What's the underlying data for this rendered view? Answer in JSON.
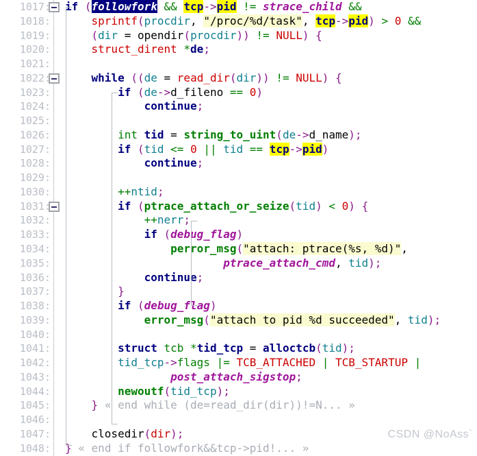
{
  "editor": {
    "first_line": 1017,
    "last_line": 1048,
    "line_number_suffix": ":",
    "fold_lines": [
      1017,
      1022,
      1031
    ],
    "fold_marker": "minus-box",
    "watermark": "CSDN @NoAss`"
  },
  "colors": {
    "background": "#ffffff",
    "gutter_text": "#b9bec6",
    "gutter_border": "#c8cdd4",
    "keyword": "#00007f",
    "type": "#007f00",
    "identifier": "#0f7f8f",
    "function": "#007f00",
    "macro": "#cc0000",
    "paren": "#8b1a8b",
    "string_bg": "#fbfbd0",
    "global_var": "#a0159b",
    "selection_bg": "#000080",
    "selection_fg": "#ffffff",
    "search_highlight_bg": "#ffff00",
    "comment": "#a8adb5",
    "watermark": "#c3c7ce"
  },
  "lines": [
    {
      "n": 1017,
      "fold": true,
      "text": "if (followfork && tcp->pid != strace_child &&"
    },
    {
      "n": 1018,
      "fold": false,
      "text": "    sprintf(procdir, \"/proc/%d/task\", tcp->pid) > 0 &&"
    },
    {
      "n": 1019,
      "fold": false,
      "text": "    (dir = opendir(procdir)) != NULL) {"
    },
    {
      "n": 1020,
      "fold": false,
      "text": "    struct_dirent *de;"
    },
    {
      "n": 1021,
      "fold": false,
      "text": ""
    },
    {
      "n": 1022,
      "fold": true,
      "text": "    while ((de = read_dir(dir)) != NULL) {"
    },
    {
      "n": 1023,
      "fold": false,
      "text": "        if (de->d_fileno == 0)"
    },
    {
      "n": 1024,
      "fold": false,
      "text": "            continue;"
    },
    {
      "n": 1025,
      "fold": false,
      "text": ""
    },
    {
      "n": 1026,
      "fold": false,
      "text": "        int tid = string_to_uint(de->d_name);"
    },
    {
      "n": 1027,
      "fold": false,
      "text": "        if (tid <= 0 || tid == tcp->pid)"
    },
    {
      "n": 1028,
      "fold": false,
      "text": "            continue;"
    },
    {
      "n": 1029,
      "fold": false,
      "text": ""
    },
    {
      "n": 1030,
      "fold": false,
      "text": "        ++ntid;"
    },
    {
      "n": 1031,
      "fold": true,
      "text": "        if (ptrace_attach_or_seize(tid) < 0) {"
    },
    {
      "n": 1032,
      "fold": false,
      "text": "            ++nerr;"
    },
    {
      "n": 1033,
      "fold": false,
      "text": "            if (debug_flag)"
    },
    {
      "n": 1034,
      "fold": false,
      "text": "                perror_msg(\"attach: ptrace(%s, %d)\","
    },
    {
      "n": 1035,
      "fold": false,
      "text": "                        ptrace_attach_cmd, tid);"
    },
    {
      "n": 1036,
      "fold": false,
      "text": "            continue;"
    },
    {
      "n": 1037,
      "fold": false,
      "text": "        }"
    },
    {
      "n": 1038,
      "fold": false,
      "text": "        if (debug_flag)"
    },
    {
      "n": 1039,
      "fold": false,
      "text": "            error_msg(\"attach to pid %d succeeded\", tid);"
    },
    {
      "n": 1040,
      "fold": false,
      "text": ""
    },
    {
      "n": 1041,
      "fold": false,
      "text": "        struct tcb *tid_tcp = alloctcb(tid);"
    },
    {
      "n": 1042,
      "fold": false,
      "text": "        tid_tcp->flags |= TCB_ATTACHED | TCB_STARTUP |"
    },
    {
      "n": 1043,
      "fold": false,
      "text": "                post_attach_sigstop;"
    },
    {
      "n": 1044,
      "fold": false,
      "text": "        newoutf(tid_tcp);"
    },
    {
      "n": 1045,
      "fold": false,
      "text": "    } « end while (de=read_dir(dir))!=N... »"
    },
    {
      "n": 1046,
      "fold": false,
      "text": ""
    },
    {
      "n": 1047,
      "fold": false,
      "text": "    closedir(dir);"
    },
    {
      "n": 1048,
      "fold": false,
      "text": "} « end if followfork&&tcp->pid!... »"
    }
  ],
  "highlights": {
    "selected_token": "followfork",
    "search_tokens": [
      "tcp",
      "pid"
    ]
  },
  "folded_comments": [
    "« end while (de=read_dir(dir))!=N... »",
    "« end if followfork&&tcp->pid!... »"
  ]
}
